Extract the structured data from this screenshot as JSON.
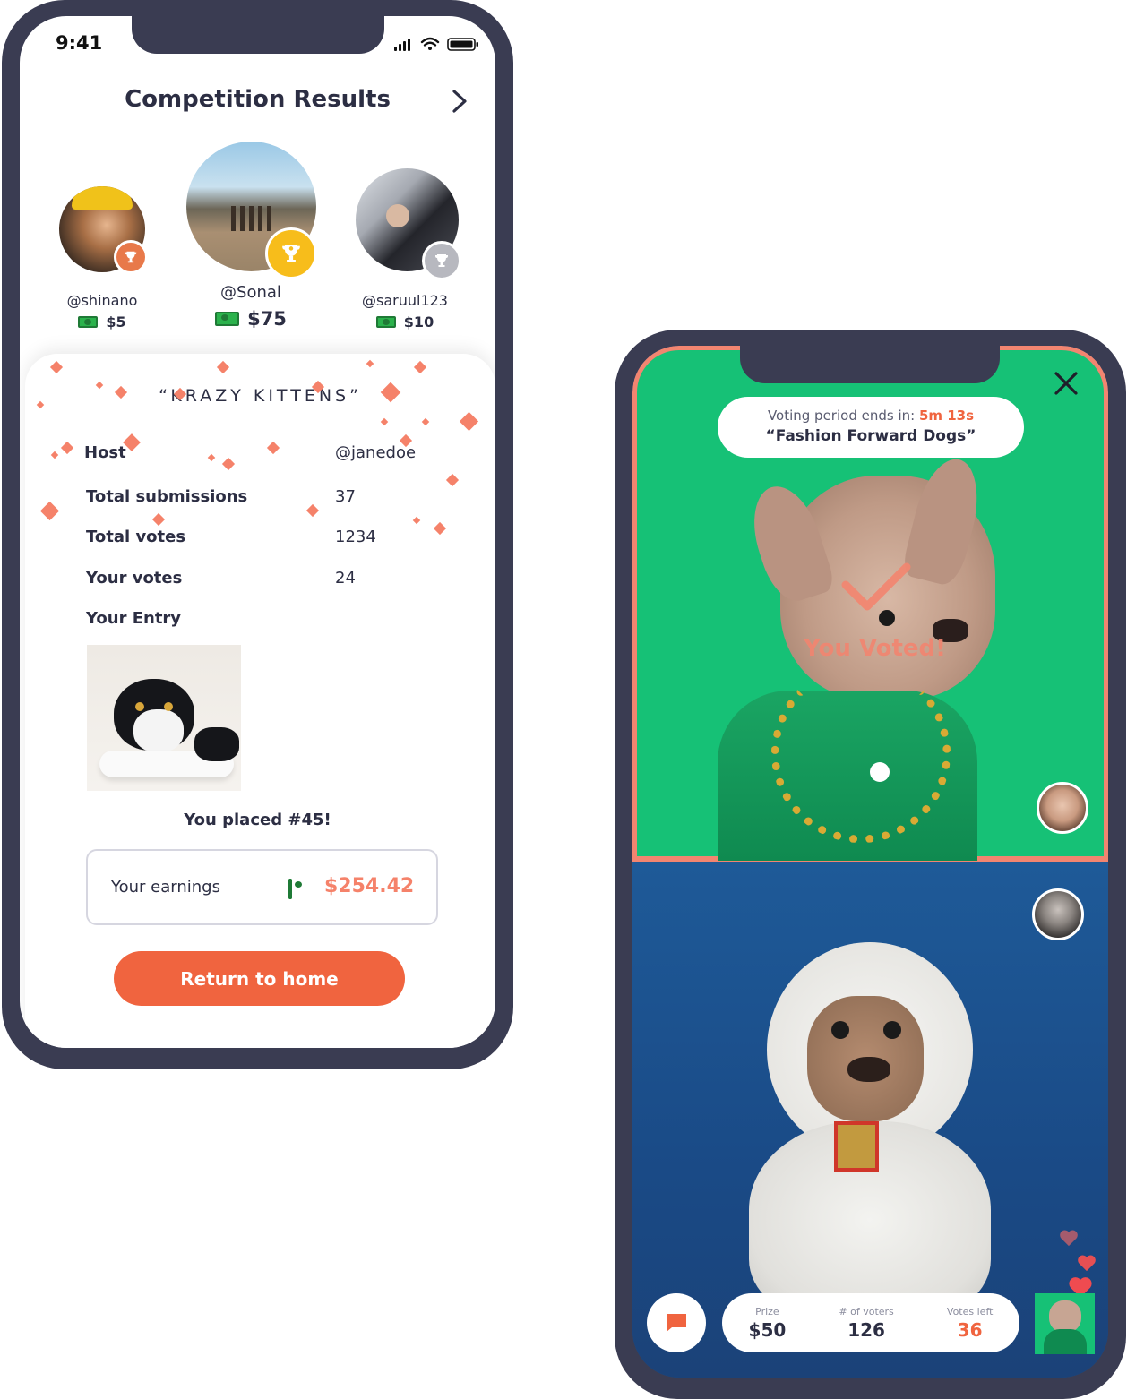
{
  "results_screen": {
    "status_time": "9:41",
    "title": "Competition Results",
    "podium": [
      {
        "place": "second",
        "username": "@shinano",
        "prize": "$5",
        "badge_color": "#e8794a"
      },
      {
        "place": "first",
        "username": "@Sonal",
        "prize": "$75",
        "badge_color": "#f7bd1b"
      },
      {
        "place": "third",
        "username": "@saruul123",
        "prize": "$10",
        "badge_color": "#b7b8bf"
      }
    ],
    "competition_name": "“KRAZY KITTENS”",
    "details": [
      {
        "label": "Host",
        "value": "@janedoe"
      },
      {
        "label": "Total submissions",
        "value": "37"
      },
      {
        "label": "Total votes",
        "value": "1234"
      },
      {
        "label": "Your votes",
        "value": "24"
      }
    ],
    "your_entry_label": "Your Entry",
    "placed_text": "You placed #45!",
    "earnings_label": "Your earnings",
    "earnings_value": "$254.42",
    "return_button": "Return to home"
  },
  "voting_screen": {
    "timer_label": "Voting period ends in: ",
    "timer_value": "5m 13s",
    "competition_title": "“Fashion Forward Dogs”",
    "voted_text": "You Voted!",
    "stats": [
      {
        "label": "Prize",
        "value": "$50"
      },
      {
        "label": "# of voters",
        "value": "126"
      },
      {
        "label": "Votes left",
        "value": "36"
      }
    ]
  },
  "colors": {
    "accent": "#f0643f",
    "frame": "#3a3c52",
    "green_bg": "#16c176",
    "blue_bg": "#1e5a98",
    "confetti": "#f5826a"
  }
}
